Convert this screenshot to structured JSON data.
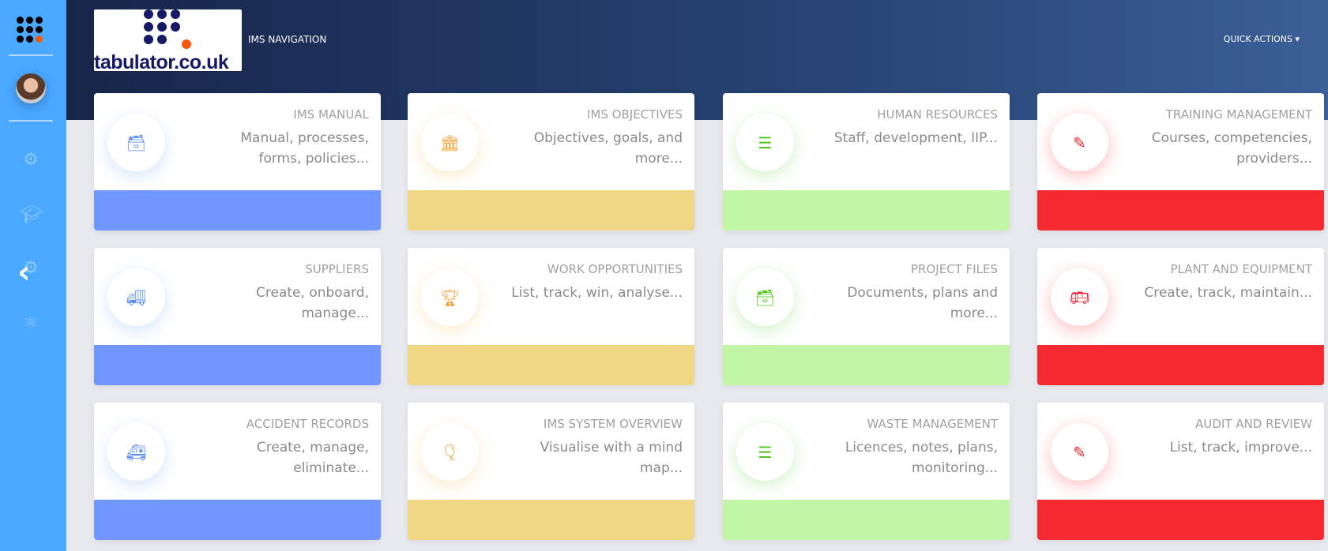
{
  "header": {
    "nav_title": "IMS NAVIGATION",
    "quick_actions": "QUICK ACTIONS ▾",
    "logo_text": "tabulator.co.uk"
  },
  "sidebar": {
    "icons": [
      "gear-icon",
      "graduation-cap-icon",
      "gear-icon",
      "atom-icon"
    ]
  },
  "colors": {
    "blue": "#7097ff",
    "yellow": "#f0d785",
    "green": "#c1f6a6",
    "red": "#f52a31",
    "sidebar": "#4aa8ff"
  },
  "cards": [
    {
      "title": "IMS MANUAL",
      "desc": "Manual, processes, forms, policies...",
      "color": "blue",
      "icon": "archive-icon"
    },
    {
      "title": "IMS OBJECTIVES",
      "desc": "Objectives, goals, and more...",
      "color": "yellow",
      "icon": "bank-icon"
    },
    {
      "title": "HUMAN RESOURCES",
      "desc": "Staff, development, IIP...",
      "color": "green",
      "icon": "list-icon"
    },
    {
      "title": "TRAINING MANAGEMENT",
      "desc": "Courses, competencies, providers...",
      "color": "red",
      "icon": "ruler-pencil-icon"
    },
    {
      "title": "SUPPLIERS",
      "desc": "Create, onboard, manage...",
      "color": "blue",
      "icon": "delivery-truck-icon"
    },
    {
      "title": "WORK OPPORTUNITIES",
      "desc": "List, track, win, analyse...",
      "color": "yellow",
      "icon": "trophy-icon"
    },
    {
      "title": "PROJECT FILES",
      "desc": "Documents, plans and more...",
      "color": "green",
      "icon": "archive-icon"
    },
    {
      "title": "PLANT AND EQUIPMENT",
      "desc": "Create, track, maintain...",
      "color": "red",
      "icon": "bus-icon"
    },
    {
      "title": "ACCIDENT RECORDS",
      "desc": "Create, manage, eliminate...",
      "color": "blue",
      "icon": "ambulance-icon"
    },
    {
      "title": "IMS SYSTEM OVERVIEW",
      "desc": "Visualise with a mind map...",
      "color": "yellow",
      "icon": "hot-air-balloon-icon"
    },
    {
      "title": "WASTE MANAGEMENT",
      "desc": "Licences, notes, plans, monitoring...",
      "color": "green",
      "icon": "list-icon"
    },
    {
      "title": "AUDIT AND REVIEW",
      "desc": "List, track, improve...",
      "color": "red",
      "icon": "ruler-pencil-icon"
    }
  ]
}
